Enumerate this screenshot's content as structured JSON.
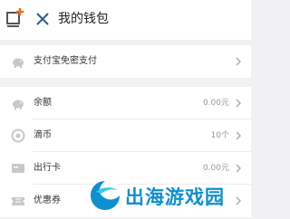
{
  "header": {
    "title": "我的钱包",
    "close_icon": "close-icon",
    "app_icon": "add-window-icon"
  },
  "sections": [
    {
      "rows": [
        {
          "icon": "piggy-bank-icon",
          "label": "支付宝免密支付",
          "value": ""
        }
      ]
    },
    {
      "rows": [
        {
          "icon": "piggy-bank-icon",
          "label": "余额",
          "value": "0.00元"
        },
        {
          "icon": "coin-icon",
          "label": "滴币",
          "value": "10个"
        },
        {
          "icon": "card-icon",
          "label": "出行卡",
          "value": "0.00元"
        },
        {
          "icon": "ticket-icon",
          "label": "优惠券",
          "value": ""
        }
      ]
    }
  ],
  "watermark": {
    "text": "出海游戏园"
  },
  "colors": {
    "accent": "#f26a1b",
    "watermark": "#0e8fd0",
    "background": "#f1f1f3"
  }
}
